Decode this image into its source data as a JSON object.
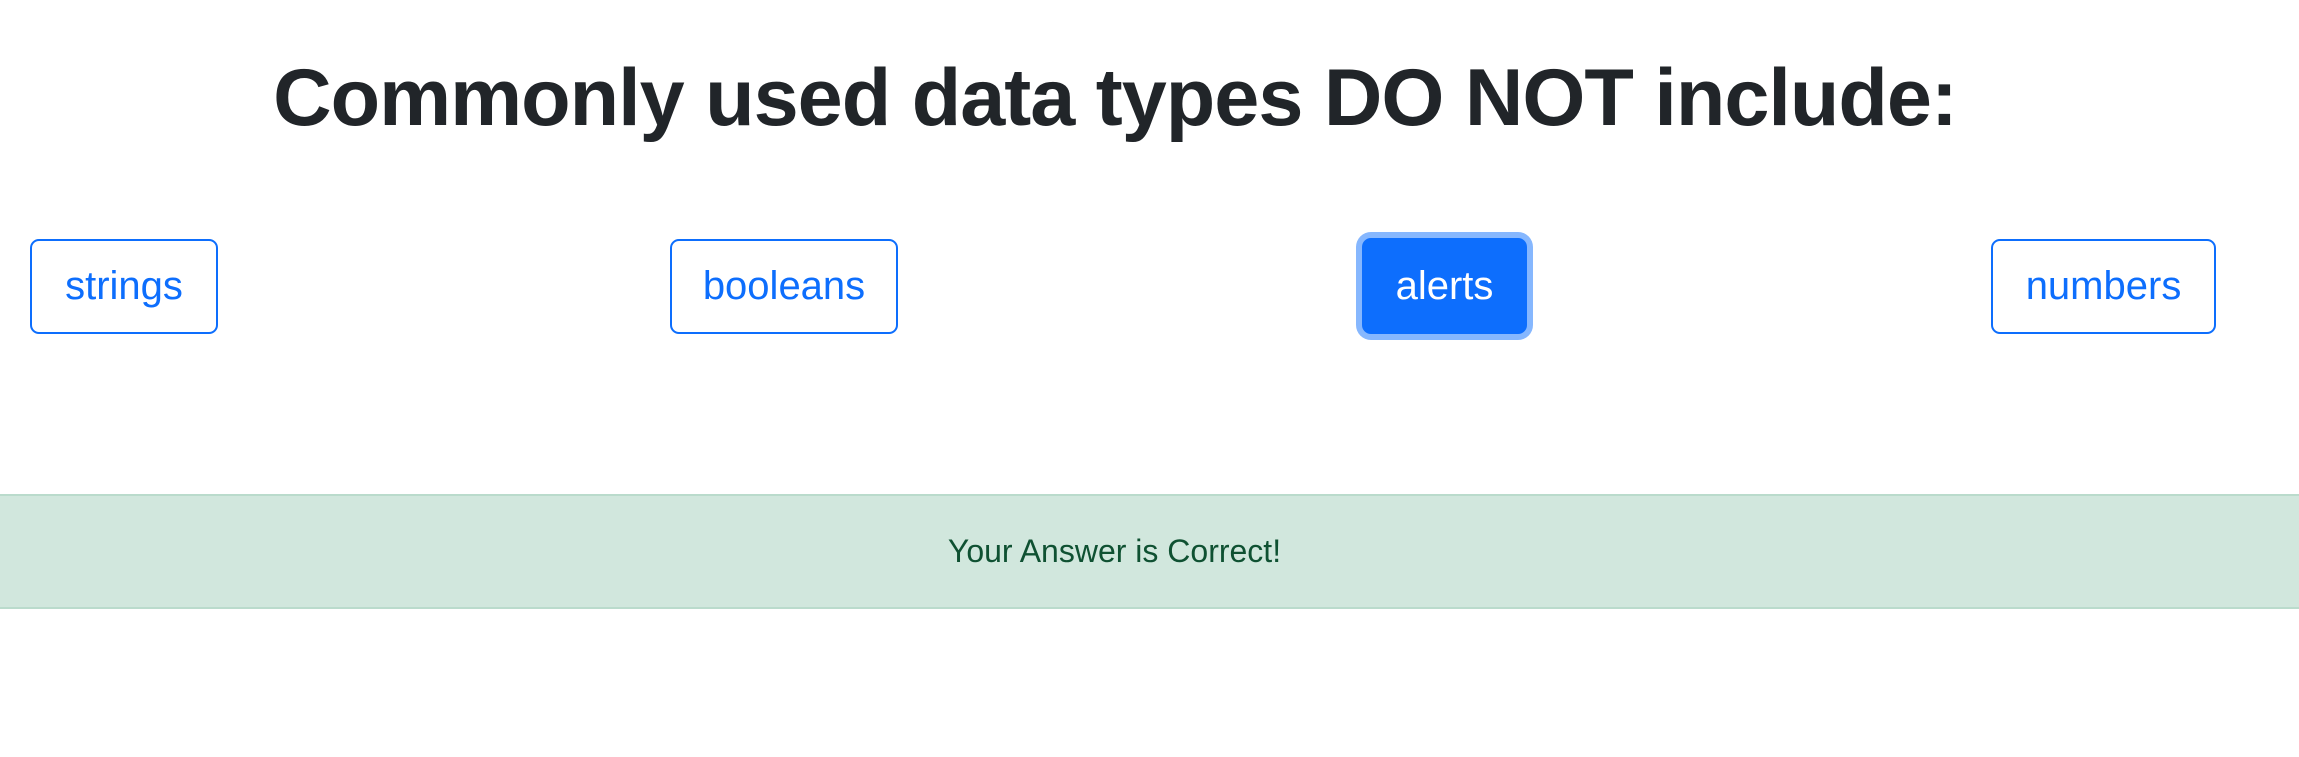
{
  "question": {
    "title": "Commonly used data types DO NOT include:"
  },
  "answers": [
    {
      "label": "strings",
      "selected": false
    },
    {
      "label": "booleans",
      "selected": false
    },
    {
      "label": "alerts",
      "selected": true
    },
    {
      "label": "numbers",
      "selected": false
    }
  ],
  "feedback": {
    "message": "Your Answer is Correct!",
    "status": "correct"
  },
  "colors": {
    "primary": "#0d6efd",
    "focus_ring": "#86b7fe",
    "success_bg": "#d1e7dd",
    "success_text": "#0f5132",
    "heading_text": "#212529"
  }
}
